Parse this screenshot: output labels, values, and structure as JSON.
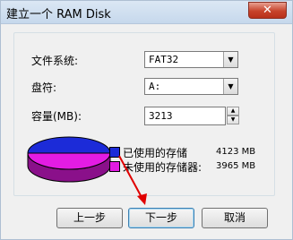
{
  "window": {
    "title": "建立一个 RAM Disk",
    "close_label": "✕"
  },
  "form": {
    "filesystem_label": "文件系统:",
    "filesystem_value": "FAT32",
    "drive_label": "盘符:",
    "drive_value": "A:",
    "capacity_label": "容量(MB):",
    "capacity_value": "3213"
  },
  "legend": {
    "used_label": "已使用的存储",
    "used_value": "4123 MB",
    "unused_label": "未使用的存储器:",
    "unused_value": "3965 MB",
    "used_color": "#1c2bd8",
    "unused_color": "#e31ce3"
  },
  "buttons": {
    "back": "上一步",
    "next": "下一步",
    "cancel": "取消"
  },
  "icons": {
    "dropdown": "chevron-down-icon",
    "spin_up": "caret-up-icon",
    "spin_down": "caret-down-icon"
  }
}
